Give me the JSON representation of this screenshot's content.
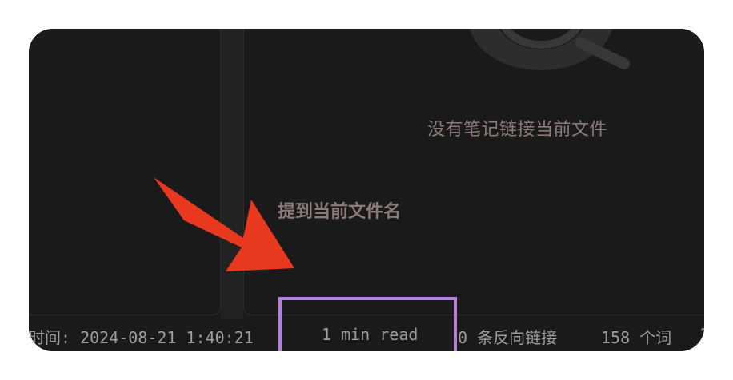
{
  "backlinks_panel": {
    "empty_message": "没有笔记链接当前文件",
    "mentions_heading": "提到当前文件名",
    "empty_icon": "search-icon"
  },
  "annotation": {
    "arrow_color": "#e8391e",
    "highlight_color": "#b57ed9"
  },
  "status_bar": {
    "modified_time": "时间: 2024-08-21 1:40:21",
    "reading_time": "1 min read",
    "backlinks": "0 条反向链接",
    "word_count": "158 个词",
    "overflow": "1"
  }
}
